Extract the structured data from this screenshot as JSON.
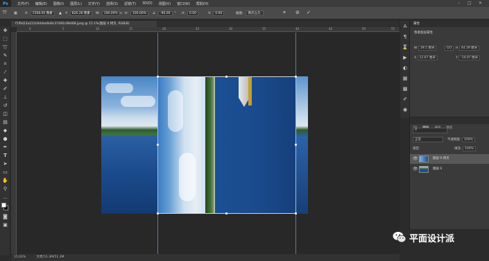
{
  "menubar": {
    "logo": "Ps",
    "items": [
      "文件(F)",
      "编辑(E)",
      "图像(I)",
      "图层(L)",
      "文字(Y)",
      "选择(S)",
      "滤镜(T)",
      "3D(D)",
      "视图(V)",
      "窗口(W)",
      "帮助(H)"
    ]
  },
  "options": {
    "x_label": "X:",
    "x_value": "1568.00 像素",
    "y_label": "Y:",
    "y_value": "826.28 像素",
    "w_label": "W:",
    "w_value": "100.00%",
    "h_label": "H:",
    "h_value": "100.00%",
    "angle_value": "-90.00",
    "h_skew_label": "H:",
    "h_skew_value": "0.00",
    "v_skew_label": "V:",
    "v_skew_value": "0.00",
    "interp_label": "插值:",
    "interp_value": "两次立方"
  },
  "document": {
    "tab_title": "f1f9d23a223c9ddea9a9c37492c98d08.jpeg @ 15.1%(图层 0 拷贝, RGB/8)",
    "ruler_marks": [
      "0",
      "5",
      "10",
      "15",
      "20",
      "25",
      "30",
      "35",
      "40",
      "45",
      "50",
      "55"
    ]
  },
  "status": {
    "zoom": "15.02%",
    "doc_size": "文档:51.3M/51.3M"
  },
  "properties_panel": {
    "tab": "属性",
    "subtitle": "像素图层属性",
    "w_label": "W",
    "w_value": "39.5 厘米",
    "go_label": "GO",
    "h_label": "H",
    "h_value": "44.39 厘米",
    "x_label": "X",
    "x_value": "12.67 厘米",
    "y_label": "Y",
    "y_value": "-14.87 厘米"
  },
  "layers_panel": {
    "tabs": [
      "3D",
      "图层",
      "通道",
      "路径"
    ],
    "kind_label": "正常",
    "opacity_label": "不透明度:",
    "opacity_value": "100%",
    "lock_label": "锁定:",
    "fill_label": "填充:",
    "fill_value": "100%",
    "layers": [
      {
        "name": "图层 0 拷贝"
      },
      {
        "name": "图层 0"
      }
    ]
  },
  "watermark": {
    "text": "平面设计派"
  }
}
